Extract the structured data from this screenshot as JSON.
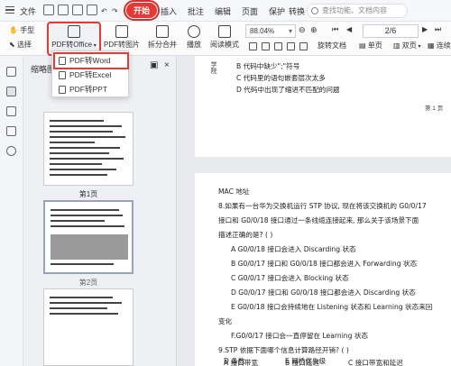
{
  "menubar": {
    "file_label": "文件",
    "start_label": "开始",
    "items": [
      "插入",
      "批注",
      "编辑",
      "页面",
      "保护",
      "转换"
    ],
    "search_placeholder": "查找功能、文档内容"
  },
  "ribbon": {
    "hand_label": "手型",
    "select_label": "选择",
    "pdf_to_office_label": "PDF转Office",
    "pdf_to_image_label": "PDF转图片",
    "split_merge_label": "拆分合并",
    "play_label": "播放",
    "read_mode_label": "阅读模式",
    "zoom_value": "88.04%",
    "page_indicator": "2/6",
    "rotate_doc_label": "旋转文档",
    "single_page_label": "单页",
    "double_page_label": "双页",
    "continuous_label": "连续"
  },
  "dropdown": {
    "items": [
      "PDF转Word",
      "PDF转Excel",
      "PDF转PPT"
    ]
  },
  "sidebar": {
    "panel_title": "缩略图",
    "thumb1_label": "第1页",
    "thumb2_label": "第2页"
  },
  "doc": {
    "page1": {
      "vertical_label": "学院",
      "lines": [
        "B 代码中缺少\";\"符号",
        "C 代码里的语句嵌套层次太多",
        "D 代码中出现了缩进不匹配的问题"
      ],
      "page_number": "第 1 页"
    },
    "page2": {
      "lines": [
        "MAC 地址",
        "8.如果有一台华为交换机运行 STP 协议, 现在将该交换机的 G0/0/17",
        "接口和 G0/0/18 接口通过一条线缆连接起来, 那么关于该场景下面",
        "描述正确的是? ( )",
        "A G0/0/18 接口会进入 Discarding 状态",
        "B G0/0/17 接口和 G0/0/18 接口都会进入 Forwarding 状态",
        "C G0/0/17 接口会进入 Blocking 状态",
        "D G0/0/17 接口和 G0/0/18 接口都会进入 Discarding 状态",
        "E G0/0/18 接口会持续地在 Listening 状态和 Learning 状态来回",
        "变化",
        "F.G0/0/17 接口会一直停留在 Learning 状态",
        "9.STP 依据下面哪个信息计算路径开销? ( )",
        "A 接口带宽",
        "B 接口延迟",
        "C 接口带宽和延迟",
        "D 条数",
        "E 网桥优先级"
      ]
    }
  },
  "colors": {
    "start_tab": "#e53935",
    "highlight_outline": "#e53935"
  }
}
